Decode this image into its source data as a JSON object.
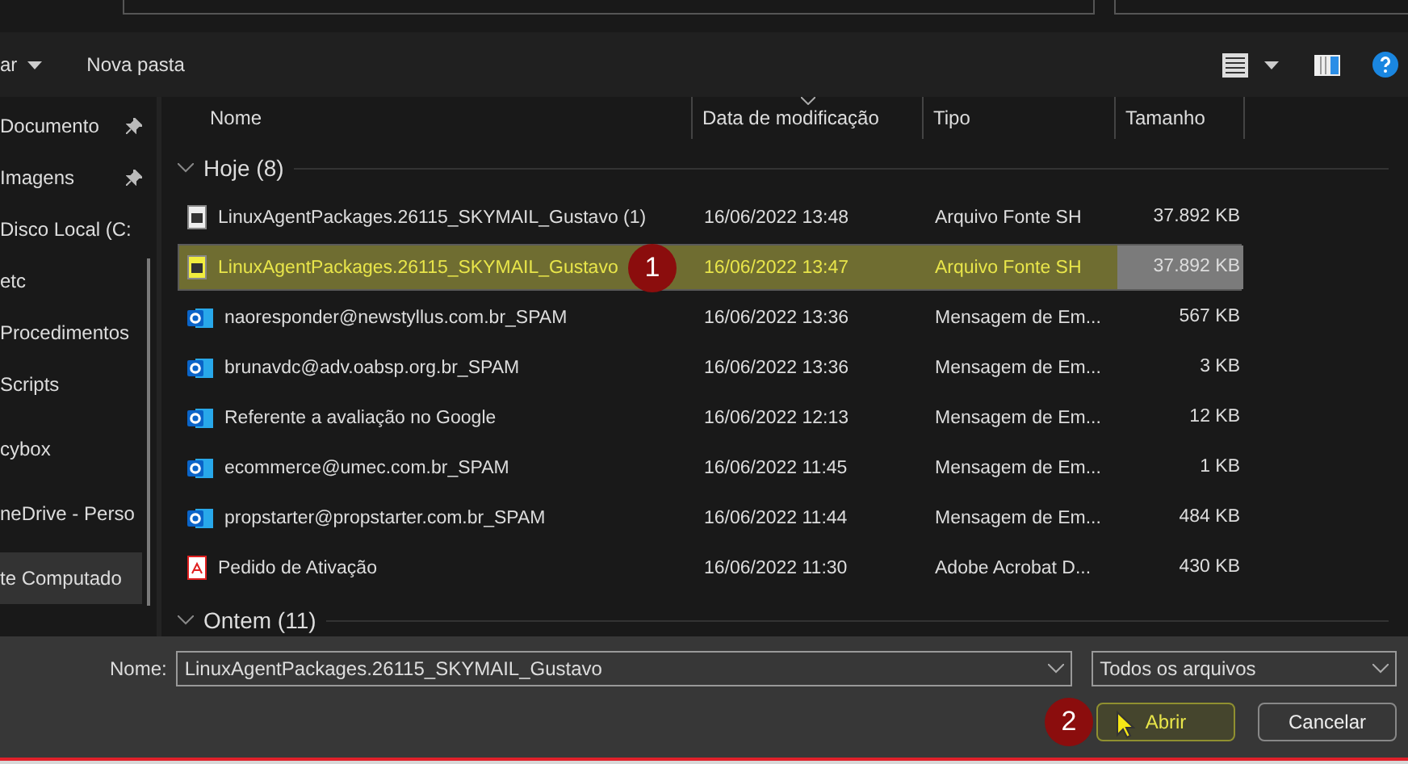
{
  "toolbar": {
    "organize": "ar",
    "new_folder": "Nova pasta"
  },
  "sidebar": {
    "sections": [
      [
        {
          "label": "Documento",
          "pinned": true,
          "selected": false
        },
        {
          "label": "Imagens",
          "pinned": true,
          "selected": false
        },
        {
          "label": "Disco Local (C:",
          "pinned": false,
          "selected": false
        },
        {
          "label": "etc",
          "pinned": false,
          "selected": false
        },
        {
          "label": "Procedimentos",
          "pinned": false,
          "selected": false
        },
        {
          "label": "Scripts",
          "pinned": false,
          "selected": false
        }
      ],
      [
        {
          "label": "cybox",
          "pinned": false,
          "selected": false
        }
      ],
      [
        {
          "label": "neDrive - Perso",
          "pinned": false,
          "selected": false
        }
      ],
      [
        {
          "label": "te Computado",
          "pinned": false,
          "selected": true
        }
      ]
    ]
  },
  "table": {
    "columns": [
      "Nome",
      "Data de modificação",
      "Tipo",
      "Tamanho"
    ],
    "groups": [
      {
        "label": "Hoje (8)",
        "expanded": true,
        "rows": [
          {
            "kind": "script",
            "name": "LinuxAgentPackages.26115_SKYMAIL_Gustavo (1)",
            "date": "16/06/2022 13:48",
            "type": "Arquivo Fonte SH",
            "size": "37.892 KB",
            "selected": false
          },
          {
            "kind": "script",
            "name": "LinuxAgentPackages.26115_SKYMAIL_Gustavo",
            "date": "16/06/2022 13:47",
            "type": "Arquivo Fonte SH",
            "size": "37.892 KB",
            "selected": true,
            "badge": "1"
          },
          {
            "kind": "mail",
            "name": "naoresponder@newstyllus.com.br_SPAM",
            "date": "16/06/2022 13:36",
            "type": "Mensagem de Em...",
            "size": "567 KB",
            "selected": false
          },
          {
            "kind": "mail",
            "name": "brunavdc@adv.oabsp.org.br_SPAM",
            "date": "16/06/2022 13:36",
            "type": "Mensagem de Em...",
            "size": "3 KB",
            "selected": false
          },
          {
            "kind": "mail",
            "name": "Referente a avaliação no Google",
            "date": "16/06/2022 12:13",
            "type": "Mensagem de Em...",
            "size": "12 KB",
            "selected": false
          },
          {
            "kind": "mail",
            "name": "ecommerce@umec.com.br_SPAM",
            "date": "16/06/2022 11:45",
            "type": "Mensagem de Em...",
            "size": "1 KB",
            "selected": false
          },
          {
            "kind": "mail",
            "name": "propstarter@propstarter.com.br_SPAM",
            "date": "16/06/2022 11:44",
            "type": "Mensagem de Em...",
            "size": "484 KB",
            "selected": false
          },
          {
            "kind": "pdf",
            "name": "Pedido de Ativação",
            "date": "16/06/2022 11:30",
            "type": "Adobe Acrobat D...",
            "size": "430 KB",
            "selected": false
          }
        ]
      },
      {
        "label": "Ontem (11)",
        "expanded": true
      }
    ]
  },
  "footer": {
    "name_label": "Nome:",
    "name_value": "LinuxAgentPackages.26115_SKYMAIL_Gustavo",
    "filter": "Todos os arquivos",
    "open_button": "Abrir",
    "open_badge": "2",
    "cancel_button": "Cancelar"
  }
}
